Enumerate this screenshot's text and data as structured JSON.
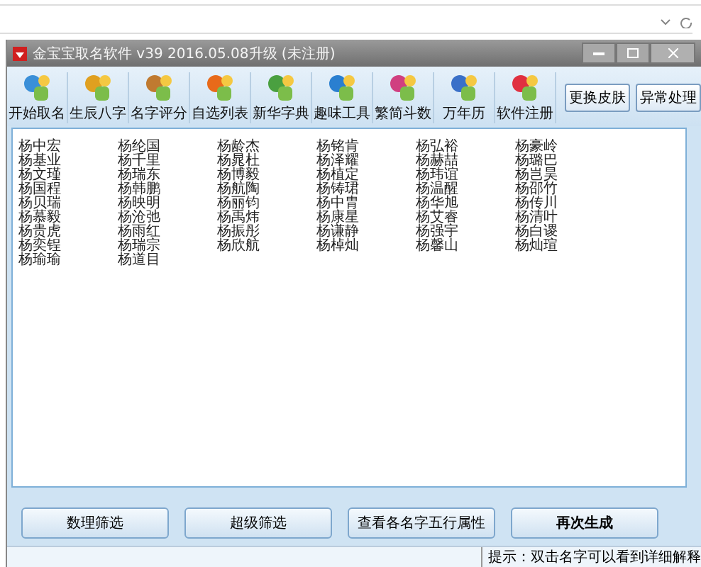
{
  "window": {
    "title": "金宝宝取名软件 v39  2016.05.08升级 (未注册)"
  },
  "toolbar": [
    {
      "label": "开始取名"
    },
    {
      "label": "生辰八字"
    },
    {
      "label": "名字评分"
    },
    {
      "label": "自选列表"
    },
    {
      "label": "新华字典"
    },
    {
      "label": "趣味工具"
    },
    {
      "label": "繁简斗数"
    },
    {
      "label": "万年历"
    },
    {
      "label": "软件注册"
    }
  ],
  "side_buttons": [
    "更换皮肤",
    "异常处理"
  ],
  "names": [
    [
      "杨中宏",
      "杨基业",
      "杨文瑾",
      "杨国程",
      "杨贝瑞",
      "杨慕毅",
      "杨贵虎",
      "杨奕锃",
      "杨瑜瑜"
    ],
    [
      "杨纶国",
      "杨千里",
      "杨瑞东",
      "杨韩鹏",
      "杨映明",
      "杨沧弛",
      "杨雨红",
      "杨瑞宗",
      "杨道目"
    ],
    [
      "杨龄杰",
      "杨晁杜",
      "杨博毅",
      "杨航陶",
      "杨丽钧",
      "杨禹炜",
      "杨振彤",
      "杨欣航"
    ],
    [
      "杨铭肯",
      "杨泽耀",
      "杨植定",
      "杨铸珺",
      "杨中胄",
      "杨康星",
      "杨谦静",
      "杨棹灿"
    ],
    [
      "杨弘裕",
      "杨赫喆",
      "杨玮谊",
      "杨温醒",
      "杨华旭",
      "杨艾睿",
      "杨强宇",
      "杨馨山"
    ],
    [
      "杨豪岭",
      "杨璐巴",
      "杨岂昊",
      "杨邵竹",
      "杨传川",
      "杨清叶",
      "杨白谡",
      "杨灿瑄"
    ]
  ],
  "buttons": [
    {
      "label": "数理筛选",
      "bold": false
    },
    {
      "label": "超级筛选",
      "bold": false
    },
    {
      "label": "查看各名字五行属性",
      "bold": false
    },
    {
      "label": "再次生成",
      "bold": true
    }
  ],
  "status_bar": "提示：双击名字可以看到详细解释"
}
